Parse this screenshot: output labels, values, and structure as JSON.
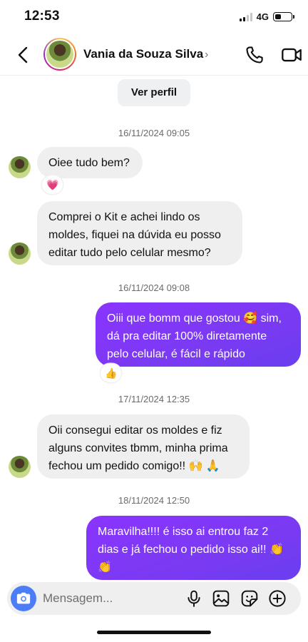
{
  "status_bar": {
    "time": "12:53",
    "network": "4G",
    "battery_level": 0.4
  },
  "header": {
    "contact_name": "Vania da Souza Silva",
    "chevron": "›"
  },
  "chat": {
    "profile_button": "Ver perfil",
    "items": [
      {
        "kind": "timestamp",
        "text": "16/11/2024 09:05"
      },
      {
        "kind": "message",
        "direction": "incoming",
        "lines": [
          "Oiee tudo bem?"
        ],
        "reaction": "💗"
      },
      {
        "kind": "message",
        "direction": "incoming",
        "lines": [
          "Comprei o Kit e achei lindo os",
          "moldes, fiquei na dúvida eu posso",
          "editar tudo pelo celular mesmo?"
        ]
      },
      {
        "kind": "timestamp",
        "text": "16/11/2024 09:08"
      },
      {
        "kind": "message",
        "direction": "outgoing",
        "lines": [
          "Oiii que bomm que gostou 🥰 sim,",
          "dá pra editar 100% diretamente",
          "pelo celular, é fácil e rápido"
        ],
        "reaction": "👍"
      },
      {
        "kind": "timestamp",
        "text": "17/11/2024 12:35"
      },
      {
        "kind": "message",
        "direction": "incoming",
        "lines": [
          "Oii consegui editar os moldes e fiz",
          "alguns convites tbmm, minha prima",
          "fechou um pedido comigo!! 🙌 🙏"
        ]
      },
      {
        "kind": "timestamp",
        "text": "18/11/2024 12:50"
      },
      {
        "kind": "message",
        "direction": "outgoing",
        "lines": [
          "Maravilha!!!! é isso ai entrou faz 2",
          "dias e já fechou o pedido isso ai!! 👏",
          "👏"
        ]
      }
    ]
  },
  "composer": {
    "placeholder": "Mensagem...",
    "value": ""
  },
  "icons": {
    "back": "chevron-left-icon",
    "phone": "phone-icon",
    "video": "video-camera-icon",
    "camera": "camera-icon",
    "mic": "microphone-icon",
    "gallery": "image-icon",
    "sticker": "sticker-icon",
    "add": "plus-circle-icon"
  },
  "colors": {
    "outgoing_bubble": "#7a3af2",
    "incoming_bubble": "#efefef",
    "camera_button": "#4c7cf6"
  }
}
